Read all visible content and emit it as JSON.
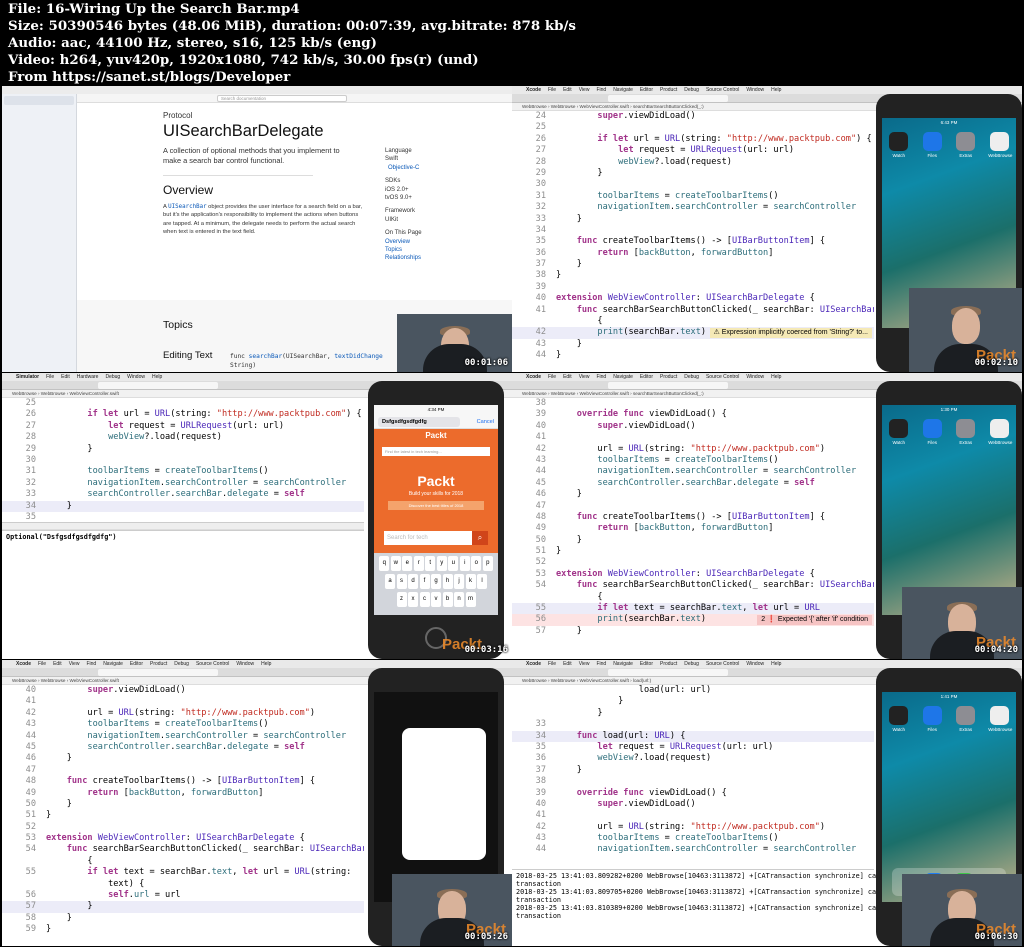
{
  "header": {
    "file_label": "File:",
    "file_name": "16-Wiring Up the Search Bar.mp4",
    "size_label": "Size:",
    "size_value": "50390546 bytes (48.06 MiB), duration: 00:07:39, avg.bitrate: 878 kb/s",
    "audio_label": "Audio:",
    "audio_value": "aac, 44100 Hz, stereo, s16, 125 kb/s (eng)",
    "video_label": "Video:",
    "video_value": "h264, yuv420p, 1920x1080, 742 kb/s, 30.00 fps(r) (und)",
    "from_label": "From",
    "from_value": "https://sanet.st/blogs/Developer"
  },
  "menus": {
    "xcode": [
      "Xcode",
      "File",
      "Edit",
      "View",
      "Find",
      "Navigate",
      "Editor",
      "Product",
      "Debug",
      "Source Control",
      "Window",
      "Help"
    ],
    "simulator": [
      "Simulator",
      "File",
      "Edit",
      "Hardware",
      "Debug",
      "Window",
      "Help"
    ]
  },
  "tiles": [
    {
      "timestamp": "00:01:06",
      "doc": {
        "kind": "Protocol",
        "title": "UISearchBarDelegate",
        "summary": "A collection of optional methods that you implement to make a search bar control functional.",
        "overview_heading": "Overview",
        "overview_link": "UISearchBar",
        "overview_text": " object provides the user interface for a search field on a bar, but it's the application's responsibility to implement the actions when buttons are tapped. At a minimum, the delegate needs to perform the actual search when text is entered in the text field.",
        "overview_prefix": "A ",
        "language_label": "Language",
        "language_swift": "Swift",
        "language_objc": "Objective-C",
        "sdks_label": "SDKs",
        "sdk_ios": "iOS 2.0+",
        "sdk_tvos": "tvOS 9.0+",
        "framework_label": "Framework",
        "framework_value": "UIKit",
        "onpage_label": "On This Page",
        "onpage_overview": "Overview",
        "onpage_topics": "Topics",
        "onpage_relationships": "Relationships",
        "topics_heading": "Topics",
        "editing_heading": "Editing Text",
        "editing_sig_prefix": "func ",
        "editing_sig_func": "searchBar",
        "editing_sig_mid": "(UISearchBar, ",
        "editing_sig_param": "textDidChange",
        "editing_sig_tail": "String)",
        "search_placeholder": "Search documentation"
      }
    },
    {
      "timestamp": "00:02:10",
      "breadcrumb": "WebBrowse › WebBrowse › WebViewController.swift › searchBarSearchButtonClicked(_:)",
      "warning": "Expression implicitly coerced from 'String?' to..."
    },
    {
      "timestamp": "00:03:16",
      "breadcrumb": "WebBrowse › WebBrowse › WebViewController.swift",
      "console": "Optional(\"Dsfgsdfgsdfgdfg\")",
      "sim_search_text": "Dsfgsdfgsdfgdfg",
      "sim_cancel": "Cancel",
      "sim_brand": "Packt",
      "sim_search_hint": "Find the latest in tech learning...",
      "sim_banner_title": "Build your skills for 2018",
      "sim_banner_btn": "Discover the best titles of 2018",
      "sim_search2": "Search for tech",
      "sim_time": "4:34 PM",
      "keyboard_row1": [
        "q",
        "w",
        "e",
        "r",
        "t",
        "y",
        "u",
        "i",
        "o",
        "p"
      ],
      "keyboard_row2": [
        "a",
        "s",
        "d",
        "f",
        "g",
        "h",
        "j",
        "k",
        "l"
      ],
      "keyboard_row3": [
        "z",
        "x",
        "c",
        "v",
        "b",
        "n",
        "m"
      ]
    },
    {
      "timestamp": "00:04:20",
      "breadcrumb": "WebBrowse › WebBrowse › WebViewController.swift › searchBarSearchButtonClicked(_:)",
      "error": "Expected '{' after 'if' condition",
      "error_count": "2"
    },
    {
      "timestamp": "00:05:26",
      "breadcrumb": "WebBrowse › WebBrowse › WebViewController.swift"
    },
    {
      "timestamp": "00:06:30",
      "breadcrumb": "WebBrowse › WebBrowse › WebViewController.swift › load(url:)",
      "console": [
        "2018-03-25 13:41:03.809282+0200 WebBrowse[10463:3113872] +[CATransaction synchronize] called within",
        "transaction",
        "2018-03-25 13:41:03.809705+0200 WebBrowse[10463:3113872] +[CATransaction synchronize] called within",
        "transaction",
        "2018-03-25 13:41:03.810389+0200 WebBrowse[10463:3113872] +[CATransaction synchronize] called within",
        "transaction"
      ],
      "sim_time": "1:41 PM"
    }
  ],
  "home_apps": [
    "Watch",
    "Files",
    "Extras",
    "WebBrowse"
  ],
  "watermark": "Packt",
  "colors": {
    "keyword": "#a1348a",
    "string": "#c12b21",
    "type": "#4b27b8",
    "property": "#2c6d7a",
    "packt": "#f08c2a"
  }
}
